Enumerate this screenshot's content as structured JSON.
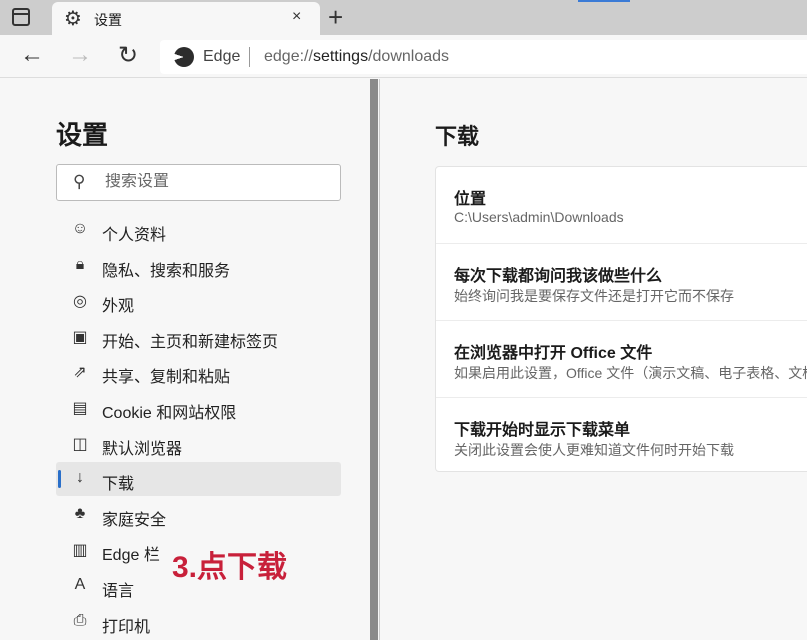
{
  "tab": {
    "title": "设置",
    "close": "×",
    "new": "+"
  },
  "nav": {
    "back": "←",
    "forward": "→",
    "refresh": "↻",
    "brand": "Edge",
    "url_pre": "edge://",
    "url_bold": "settings",
    "url_post": "/downloads"
  },
  "sidebar": {
    "title": "设置",
    "search_placeholder": "搜索设置",
    "items": [
      {
        "label": "个人资料",
        "icon": "profile-icon",
        "glyph": "☺"
      },
      {
        "label": "隐私、搜索和服务",
        "icon": "lock-icon",
        "glyph": "🔒︎"
      },
      {
        "label": "外观",
        "icon": "palette-icon",
        "glyph": "◎"
      },
      {
        "label": "开始、主页和新建标签页",
        "icon": "home-page-icon",
        "glyph": "▣"
      },
      {
        "label": "共享、复制和粘贴",
        "icon": "share-icon",
        "glyph": "⇗"
      },
      {
        "label": "Cookie 和网站权限",
        "icon": "cookie-icon",
        "glyph": "▤"
      },
      {
        "label": "默认浏览器",
        "icon": "browser-icon",
        "glyph": "◫"
      },
      {
        "label": "下载",
        "icon": "download-icon",
        "glyph": "↓",
        "selected": true
      },
      {
        "label": "家庭安全",
        "icon": "family-icon",
        "glyph": "♣"
      },
      {
        "label": "Edge 栏",
        "icon": "edge-bar-icon",
        "glyph": "▥"
      },
      {
        "label": "语言",
        "icon": "language-icon",
        "glyph": "A"
      },
      {
        "label": "打印机",
        "icon": "printer-icon",
        "glyph": "⎙"
      }
    ]
  },
  "annotation": "3.点下载",
  "main": {
    "title": "下载",
    "rows": [
      {
        "title": "位置",
        "desc": "C:\\Users\\admin\\Downloads"
      },
      {
        "title": "每次下载都询问我该做些什么",
        "desc": "始终询问我是要保存文件还是打开它而不保存"
      },
      {
        "title": "在浏览器中打开 Office 文件",
        "desc": "如果启用此设置，Office 文件（演示文稿、电子表格、文档）"
      },
      {
        "title": "下载开始时显示下载菜单",
        "desc": "关闭此设置会使人更难知道文件何时开始下载"
      }
    ]
  },
  "colors": {
    "accent": "#2a6fc9",
    "annotation": "#c8203a"
  }
}
